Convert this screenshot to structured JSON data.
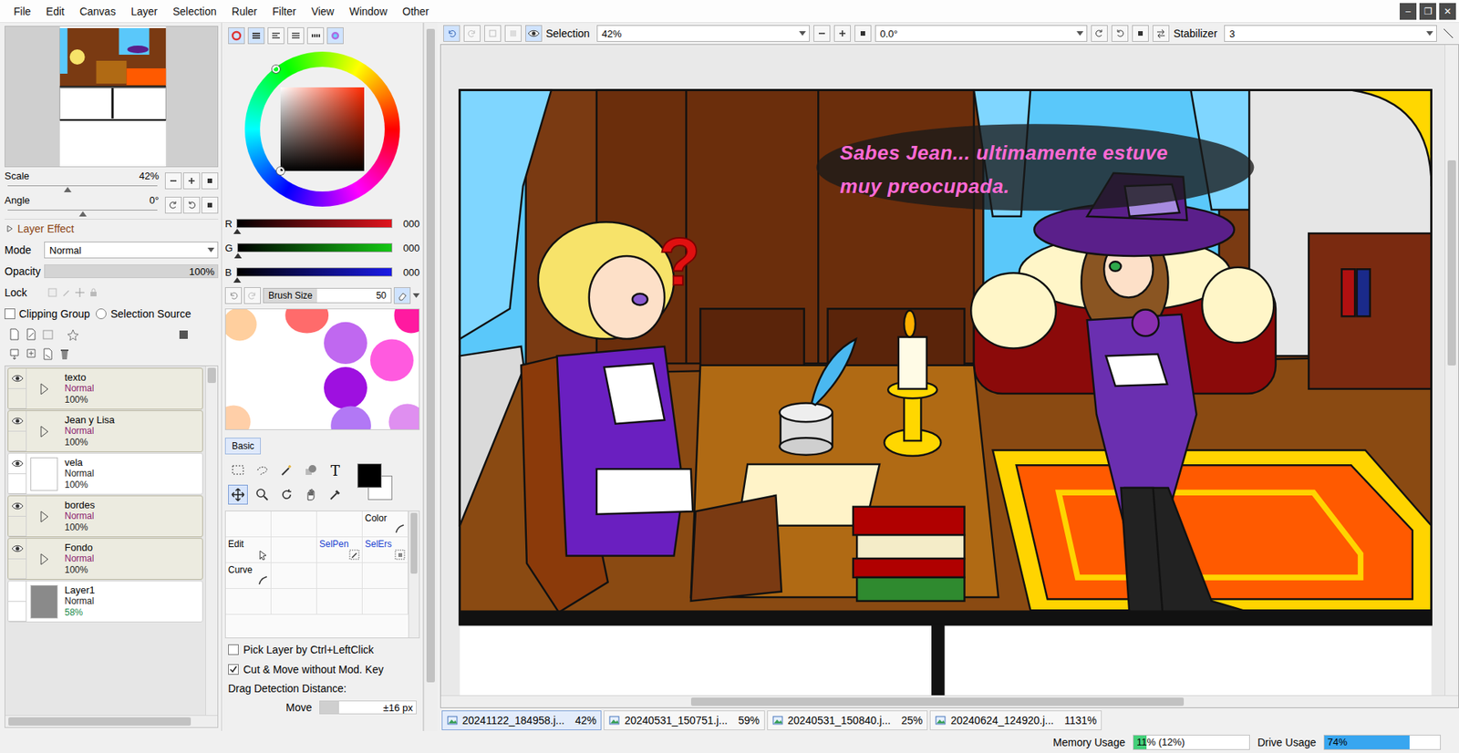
{
  "menu": [
    "File",
    "Edit",
    "Canvas",
    "Layer",
    "Selection",
    "Ruler",
    "Filter",
    "View",
    "Window",
    "Other"
  ],
  "window_controls": [
    "–",
    "❐",
    "✕"
  ],
  "navigator": {
    "scale_label": "Scale",
    "scale": "42%",
    "scale_level": 0.4,
    "angle_label": "Angle",
    "angle": "0°",
    "angle_level": 0.5
  },
  "layer_effect": {
    "label": "Layer Effect",
    "expanded": false
  },
  "mode": {
    "label": "Mode",
    "value": "Normal"
  },
  "opacity": {
    "label": "Opacity",
    "value": "100%",
    "level": 1
  },
  "lock": {
    "label": "Lock"
  },
  "clipping_group": {
    "label": "Clipping Group",
    "checked": false
  },
  "selection_source": {
    "label": "Selection Source",
    "selected": false
  },
  "layers": [
    {
      "name": "texto",
      "kind": "folder",
      "mode": "Normal",
      "opacity": "100%",
      "opacity_level": 1,
      "visible": true,
      "selected": false,
      "expanded": false,
      "thumb": "#ecebe0"
    },
    {
      "name": "Jean y Lisa",
      "kind": "folder",
      "mode": "Normal",
      "opacity": "100%",
      "opacity_level": 1,
      "visible": true,
      "selected": false,
      "expanded": false,
      "thumb": "#ecebe0"
    },
    {
      "name": "vela",
      "kind": "layer",
      "mode": "Normal",
      "opacity": "100%",
      "opacity_level": 1,
      "visible": true,
      "selected": false,
      "expanded": false,
      "thumb": "#ffffff"
    },
    {
      "name": "bordes",
      "kind": "folder",
      "mode": "Normal",
      "opacity": "100%",
      "opacity_level": 1,
      "visible": true,
      "selected": false,
      "expanded": false,
      "thumb": "#ecebe0"
    },
    {
      "name": "Fondo",
      "kind": "folder",
      "mode": "Normal",
      "opacity": "100%",
      "opacity_level": 1,
      "visible": true,
      "selected": false,
      "expanded": false,
      "thumb": "#ecebe0"
    },
    {
      "name": "Layer1",
      "kind": "layer",
      "mode": "Normal",
      "opacity": "58%",
      "opacity_level": 0.58,
      "visible": false,
      "selected": false,
      "expanded": false,
      "thumb": "#8a8a8a"
    }
  ],
  "color_panels": [
    {
      "kind": "wheel",
      "selected": true
    },
    {
      "kind": "rgb",
      "selected": true
    },
    {
      "kind": "hsv",
      "selected": false
    },
    {
      "kind": "palette",
      "selected": false
    },
    {
      "kind": "swatches",
      "selected": false
    },
    {
      "kind": "scratch",
      "selected": true
    }
  ],
  "color_channels": [
    {
      "name": "R",
      "value": "000",
      "level": 0,
      "color": "#e0141e"
    },
    {
      "name": "G",
      "value": "000",
      "level": 0,
      "color": "#14c814"
    },
    {
      "name": "B",
      "value": "000",
      "level": 0,
      "color": "#1a1ae6"
    }
  ],
  "brush": {
    "label": "Brush Size",
    "value": "50",
    "level": 0.42
  },
  "tool_tab": {
    "label": "Basic",
    "selected": true
  },
  "basic_tools": [
    {
      "kind": "rect-select",
      "selected": false,
      "glyph": ""
    },
    {
      "kind": "lasso",
      "selected": false,
      "glyph": ""
    },
    {
      "kind": "magic-wand",
      "selected": false,
      "glyph": ""
    },
    {
      "kind": "shape",
      "selected": false,
      "glyph": ""
    },
    {
      "kind": "text",
      "selected": false,
      "glyph": "T"
    },
    {
      "kind": "move",
      "selected": true,
      "glyph": ""
    },
    {
      "kind": "zoom",
      "selected": false,
      "glyph": ""
    },
    {
      "kind": "rotate",
      "selected": false,
      "glyph": ""
    },
    {
      "kind": "hand",
      "selected": false,
      "glyph": ""
    },
    {
      "kind": "eyedropper",
      "selected": false,
      "glyph": ""
    }
  ],
  "current_colors": {
    "foreground": "#000000",
    "background": "#ffffff"
  },
  "tool_grid": [
    [
      null,
      null,
      null,
      {
        "label": "Color",
        "kind": "curve",
        "color": "#000000"
      }
    ],
    [
      {
        "label": "Edit",
        "kind": "arrow",
        "color": "#000000"
      },
      null,
      {
        "label": "SelPen",
        "kind": "selpen",
        "color": "#1a3fd0"
      },
      {
        "label": "SelErs",
        "kind": "selers",
        "color": "#1a3fd0"
      }
    ],
    [
      {
        "label": "Curve",
        "kind": "curve",
        "color": "#000000"
      },
      null,
      null,
      null
    ],
    [
      null,
      null,
      null,
      null
    ]
  ],
  "options": [
    {
      "label": "Pick Layer by Ctrl+LeftClick",
      "checked": false
    },
    {
      "label": "Cut & Move without Mod. Key",
      "checked": true
    }
  ],
  "drag_detection": {
    "label": "Drag Detection Distance:",
    "move_label": "Move",
    "move_value": "±16 px",
    "level": 0.2
  },
  "toolbar": {
    "selection_label": "Selection",
    "selection_visible": true,
    "zoom": "42%",
    "angle": "0.0°",
    "stabilizer_label": "Stabilizer",
    "stabilizer": "3"
  },
  "canvas": {
    "speech": [
      "Sabes Jean... ultimamente estuve",
      "muy preocupada."
    ],
    "mark": "?"
  },
  "documents": [
    {
      "name": "20241122_184958.j...",
      "zoom": "42%",
      "selected": true
    },
    {
      "name": "20240531_150751.j...",
      "zoom": "59%",
      "selected": false
    },
    {
      "name": "20240531_150840.j...",
      "zoom": "25%",
      "selected": false
    },
    {
      "name": "20240624_124920.j...",
      "zoom": "1131%",
      "selected": false
    }
  ],
  "status": {
    "memory_label": "Memory Usage",
    "memory": "11% (12%)",
    "memory_level": 0.11,
    "drive_label": "Drive Usage",
    "drive": "74%",
    "drive_level": 0.74
  }
}
